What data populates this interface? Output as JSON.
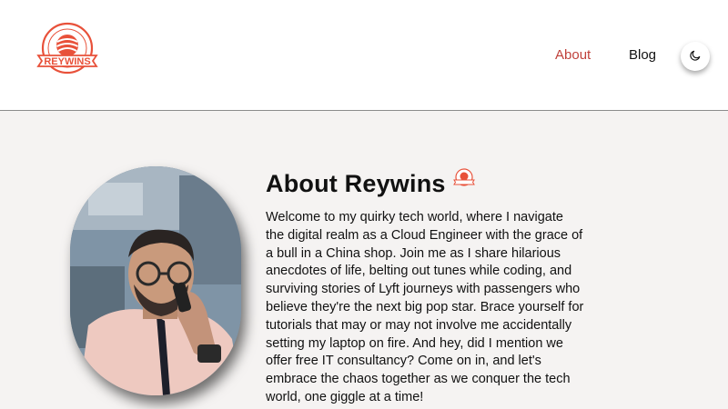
{
  "brand": {
    "logo_text": "REYWINS",
    "logo_ring_text": "INFINITE POSSIBILITIES",
    "accent_color": "#e8513a"
  },
  "nav": {
    "items": [
      {
        "label": "About",
        "active": true
      },
      {
        "label": "Blog",
        "active": false
      }
    ],
    "theme_toggle_icon": "moon-icon",
    "active_color": "#c0413b"
  },
  "about": {
    "title": "About Reywins",
    "body": "Welcome to my quirky tech world, where I navigate the digital realm as a Cloud Engineer with the grace of a bull in a China shop. Join me as I share hilarious anecdotes of life, belting out tunes while coding, and surviving stories of Lyft journeys with passengers who believe they're the next big pop star. Brace yourself for tutorials that may or may not involve me accidentally setting my laptop on fire. And hey, did I mention we offer free IT consultancy? Come on in, and let's embrace the chaos together as we conquer the tech world, one giggle at a time!"
  }
}
